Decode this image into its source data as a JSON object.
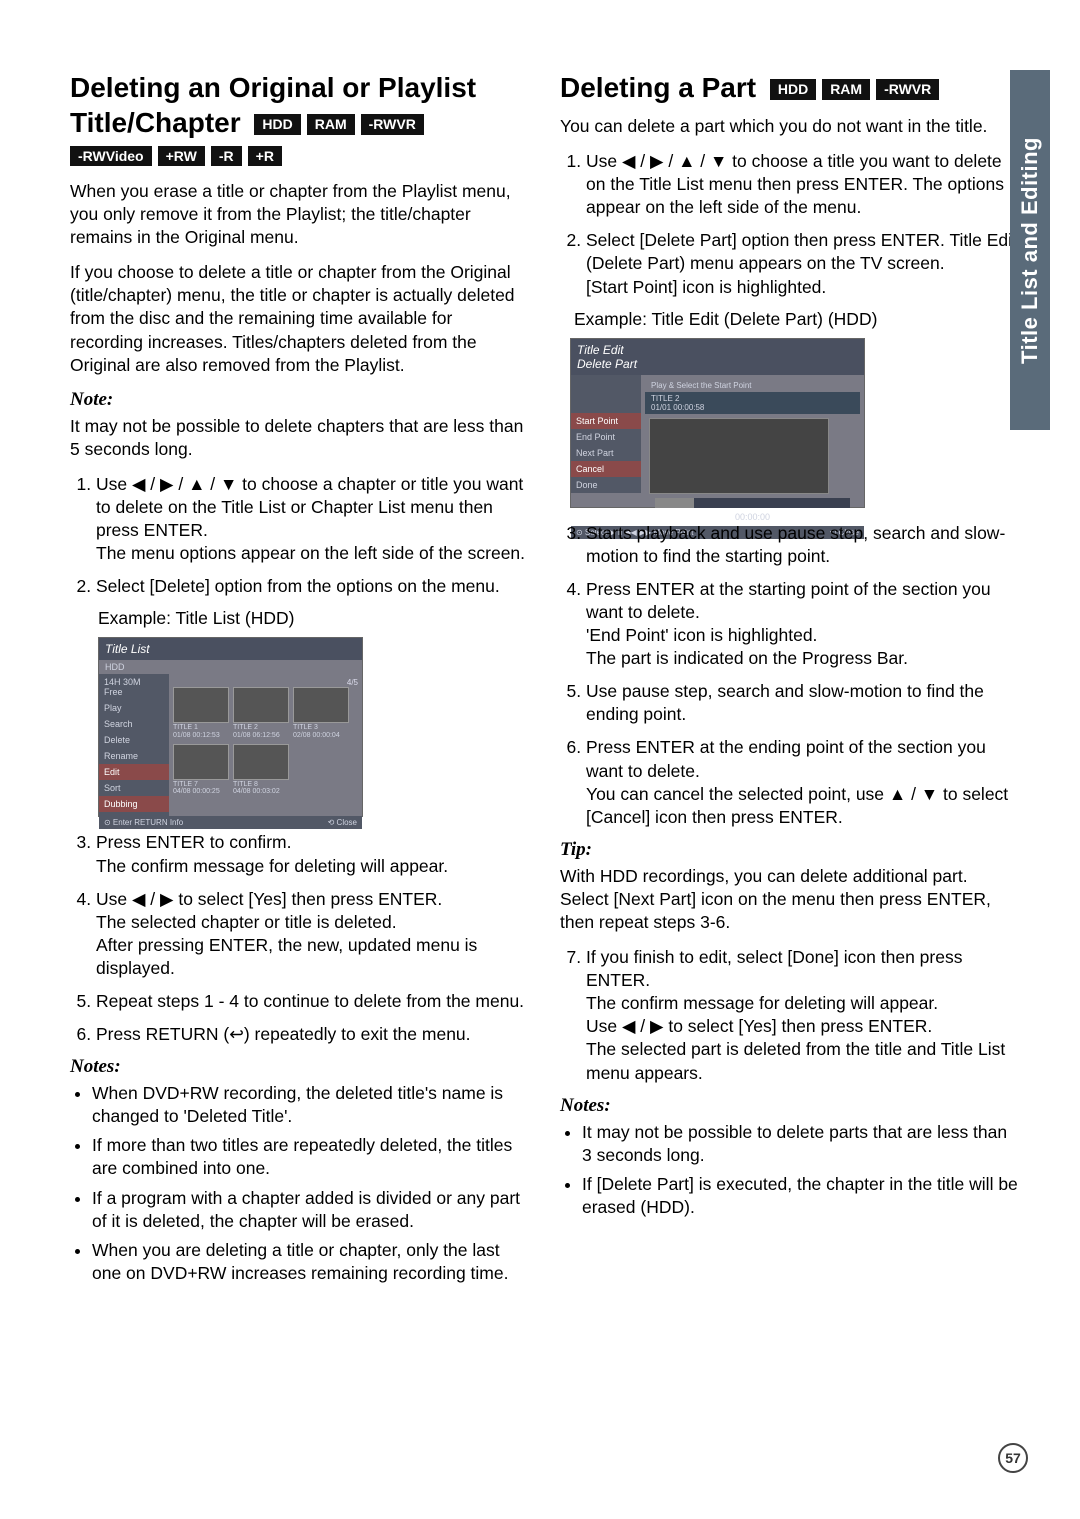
{
  "sideTab": "Title List and Editing",
  "pageNumber": "57",
  "left": {
    "title": "Deleting an Original or Playlist Title/Chapter",
    "tags1": [
      "HDD",
      "RAM",
      "-RWVR"
    ],
    "tags2": [
      "-RWVideo",
      "+RW",
      "-R",
      "+R"
    ],
    "p1": "When you erase a title or chapter from the Playlist menu, you only remove it from the Playlist; the title/chapter remains in the Original menu.",
    "p2": "If you choose to delete a title or chapter from the Original (title/chapter) menu, the title or chapter is actually deleted from the disc and the remaining time available for recording increases. Titles/chapters deleted from the Original are also removed from the Playlist.",
    "noteTitle": "Note:",
    "noteText": "It may not be possible to delete chapters that are less than 5 seconds long.",
    "ol": [
      "Use ◀ / ▶ / ▲ / ▼ to choose a chapter or title you want to delete on the Title List or Chapter List menu then press ENTER.\nThe menu options appear on the left side of the screen.",
      "Select [Delete] option from the options on the menu."
    ],
    "exampleLabel": "Example: Title List (HDD)",
    "ss1": {
      "header": "Title List",
      "hdd": "HDD",
      "sideTop": "14H 30M\nFree",
      "menu": [
        "Play",
        "Search",
        "Delete",
        "Rename",
        "Edit",
        "Sort",
        "Dubbing"
      ],
      "thumbs": [
        {
          "t": "TITLE 1",
          "d": "01/08  00:12:53"
        },
        {
          "t": "TITLE 2",
          "d": "01/08  06:12:56"
        },
        {
          "t": "TITLE 3",
          "d": "02/08  00:00:04"
        },
        {
          "t": "TITLE 7",
          "d": "04/08  00:00:25"
        },
        {
          "t": "TITLE 8",
          "d": "04/08  00:03:02"
        }
      ],
      "pager": "4/5",
      "footerLeft": "⊙ Enter   RETURN Info",
      "footerRight": "⟲ Close"
    },
    "ol2": [
      "Press ENTER to confirm.\nThe confirm message for deleting will appear.",
      "Use ◀ / ▶ to select [Yes] then press ENTER.\nThe selected chapter or title is deleted.\nAfter pressing ENTER, the new, updated menu is displayed.",
      "Repeat steps 1 - 4 to continue to delete from the menu.",
      "Press RETURN (↩) repeatedly to exit the menu."
    ],
    "notesTitle": "Notes:",
    "notes": [
      "When DVD+RW recording, the deleted title's name is changed to 'Deleted Title'.",
      "If more than two titles are repeatedly deleted, the titles are combined into one.",
      "If a program with a chapter added is divided or any part of it is deleted, the chapter will be erased.",
      "When you are deleting a title or chapter, only the last one on DVD+RW increases remaining recording time."
    ]
  },
  "right": {
    "title": "Deleting a Part",
    "tags": [
      "HDD",
      "RAM",
      "-RWVR"
    ],
    "p1": "You can delete a part which you do not want in the title.",
    "ol": [
      "Use ◀ / ▶ / ▲ / ▼ to choose a title you want to delete on the Title List menu then press ENTER. The options appear on the left side of the menu.",
      "Select [Delete Part] option then press ENTER. Title Edit (Delete Part) menu appears on the TV screen.\n[Start Point] icon is highlighted."
    ],
    "exampleLabel": "Example: Title Edit (Delete Part) (HDD)",
    "ss2": {
      "header": "Title Edit\nDelete Part",
      "infoTop": "Play & Select the Start Point",
      "infoLine": "TITLE 2\n01/01   00:00:58",
      "side": [
        "Start Point",
        "End Point",
        "Next Part",
        "Cancel",
        "Done"
      ],
      "time": "00:00:00",
      "footerLeft": "⊙ Select  ▶ II ◀◀ ▶▶ Move Point",
      "footerRight": "⟲ Close"
    },
    "ol2": [
      "Starts playback and use pause step, search and slow-motion to find the starting point.",
      "Press ENTER at the starting point of the section you want to delete.\n'End Point' icon is highlighted.\nThe part is indicated on the Progress Bar.",
      "Use pause step, search and slow-motion to find the ending point.",
      "Press ENTER at the ending point of the section you want to delete.\nYou can cancel the selected point, use ▲ / ▼ to select [Cancel] icon then press ENTER."
    ],
    "tipTitle": "Tip:",
    "tipText": "With HDD recordings, you can delete additional part. Select [Next Part] icon on the menu then press ENTER, then repeat steps 3-6.",
    "ol3": [
      "If you finish to edit, select [Done] icon then press ENTER.\nThe confirm message for deleting will appear.\nUse ◀ / ▶ to select [Yes] then press ENTER.\nThe selected part is deleted from the title and Title List menu appears."
    ],
    "notesTitle": "Notes:",
    "notes": [
      "It may not be possible to delete parts that are less than 3 seconds long.",
      "If [Delete Part] is executed, the chapter in the title will be erased (HDD)."
    ]
  }
}
